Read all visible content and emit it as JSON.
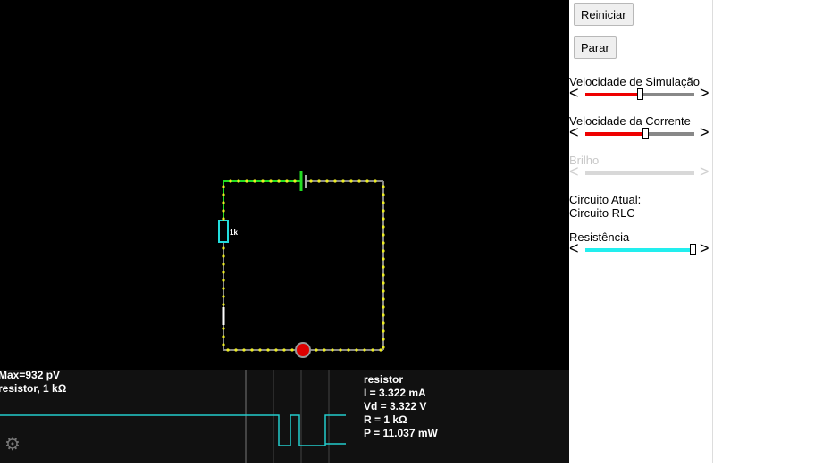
{
  "circuit": {
    "resistor_label": "1k"
  },
  "scope": {
    "left_line1": "Max=932 pV",
    "left_line2": "resistor, 1 kΩ",
    "info_title": "resistor",
    "info_current": "I = 3.322 mA",
    "info_voltage": "Vd = 3.322 V",
    "info_resistance": "R = 1 kΩ",
    "info_power": "P = 11.037 mW",
    "settings_icon": "gear-icon"
  },
  "panel": {
    "reset_label": "Reiniciar",
    "stop_label": "Parar",
    "sim_speed_label": "Velocidade de Simulação",
    "sim_speed_value": 0.5,
    "current_speed_label": "Velocidade da Corrente",
    "current_speed_value": 0.55,
    "brightness_label": "Brilho",
    "circuit_label": "Circuito Atual:",
    "circuit_name": "Circuito RLC",
    "resistance_label": "Resistência",
    "resistance_value": 1.0,
    "colors": {
      "sim_fill": "#ee0000",
      "current_fill": "#ee0000",
      "resistance_fill": "#22eeee",
      "brightness_fill": "#d8d8d8"
    }
  }
}
